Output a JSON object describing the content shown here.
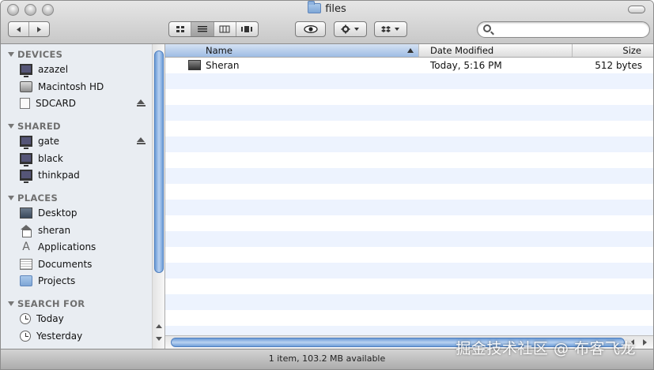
{
  "window": {
    "title": "files"
  },
  "toolbar": {
    "back_icon": "arrow-left-icon",
    "forward_icon": "arrow-right-icon",
    "views": [
      "icon-view",
      "list-view",
      "column-view",
      "coverflow-view"
    ],
    "active_view": "list-view",
    "quicklook_icon": "eye-icon",
    "action_icon": "gear-icon",
    "dropbox_icon": "dropbox-icon"
  },
  "search": {
    "value": "",
    "placeholder": ""
  },
  "sidebar": {
    "sections": [
      {
        "label": "DEVICES",
        "items": [
          {
            "label": "azazel",
            "icon": "computer-icon"
          },
          {
            "label": "Macintosh HD",
            "icon": "hard-drive-icon"
          },
          {
            "label": "SDCARD",
            "icon": "sd-card-icon",
            "eject": true
          }
        ]
      },
      {
        "label": "SHARED",
        "items": [
          {
            "label": "gate",
            "icon": "monitor-icon",
            "eject": true
          },
          {
            "label": "black",
            "icon": "monitor-icon"
          },
          {
            "label": "thinkpad",
            "icon": "monitor-icon"
          }
        ]
      },
      {
        "label": "PLACES",
        "items": [
          {
            "label": "Desktop",
            "icon": "desktop-icon"
          },
          {
            "label": "sheran",
            "icon": "home-icon"
          },
          {
            "label": "Applications",
            "icon": "applications-icon"
          },
          {
            "label": "Documents",
            "icon": "documents-icon"
          },
          {
            "label": "Projects",
            "icon": "folder-icon"
          }
        ]
      },
      {
        "label": "SEARCH FOR",
        "items": [
          {
            "label": "Today",
            "icon": "clock-icon"
          },
          {
            "label": "Yesterday",
            "icon": "clock-icon"
          }
        ]
      }
    ]
  },
  "list": {
    "columns": {
      "name": "Name",
      "date": "Date Modified",
      "size": "Size"
    },
    "sorted_by": "Name",
    "rows": [
      {
        "name": "Sheran",
        "date": "Today, 5:16 PM",
        "size": "512 bytes",
        "icon": "executable-file-icon"
      }
    ]
  },
  "status": {
    "text": "1 item, 103.2 MB available"
  },
  "watermark": {
    "text": "掘金技术社区 @ 布客飞龙"
  },
  "colors": {
    "selection_accent": "#9ebce4",
    "stripe": "#edf3fe",
    "sidebar_bg": "#e9edf2"
  }
}
